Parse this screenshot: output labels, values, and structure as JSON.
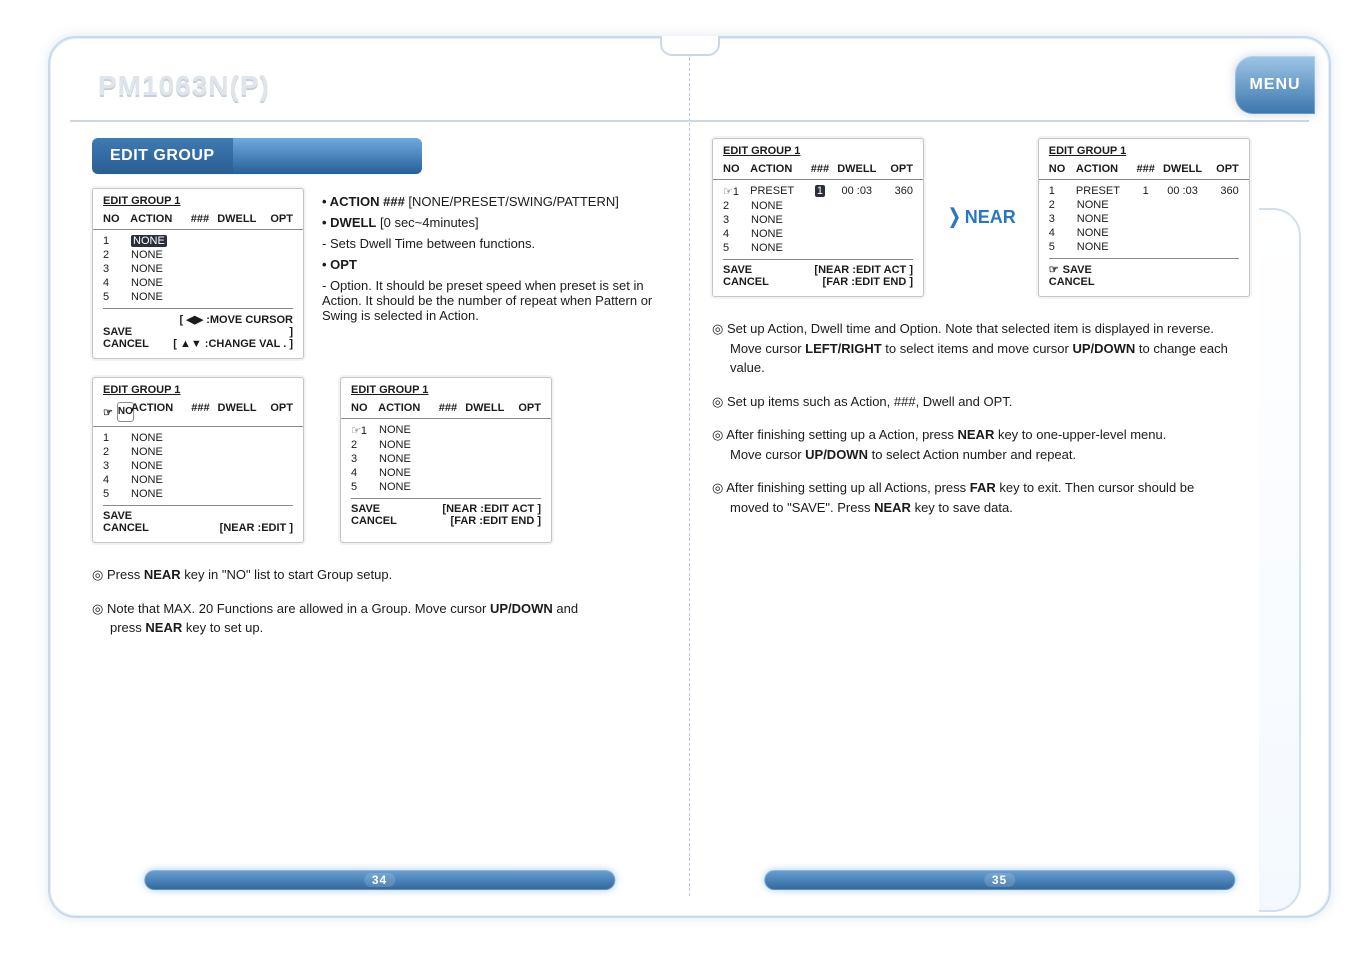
{
  "brand": "PM1063N(P)",
  "menu_label": "MENU",
  "section_title": "EDIT GROUP",
  "panels": {
    "p1": {
      "title": "EDIT GROUP   1",
      "head": {
        "no": "NO",
        "action": "ACTION",
        "hash": "###",
        "dwell": "DWELL",
        "opt": "OPT"
      },
      "rows": [
        {
          "no": "1",
          "action": "NONE",
          "rev": true
        },
        {
          "no": "2",
          "action": "NONE"
        },
        {
          "no": "3",
          "action": "NONE"
        },
        {
          "no": "4",
          "action": "NONE"
        },
        {
          "no": "5",
          "action": "NONE"
        }
      ],
      "foot_l1": "SAVE",
      "foot_l2": "CANCEL",
      "foot_r1": "[ ◀▶ :MOVE CURSOR   ]",
      "foot_r2": "[ ▲▼ :CHANGE VAL  .  ]"
    },
    "p2": {
      "title": "EDIT GROUP   1",
      "head": {
        "no": "NO",
        "action": "ACTION",
        "hash": "###",
        "dwell": "DWELL",
        "opt": "OPT"
      },
      "sel_head": "no",
      "rows": [
        {
          "no": "1",
          "action": "NONE"
        },
        {
          "no": "2",
          "action": "NONE"
        },
        {
          "no": "3",
          "action": "NONE"
        },
        {
          "no": "4",
          "action": "NONE"
        },
        {
          "no": "5",
          "action": "NONE"
        }
      ],
      "foot_l1": "SAVE",
      "foot_l2": "CANCEL",
      "foot_r2": "[NEAR  :EDIT ]"
    },
    "p3": {
      "title": "EDIT GROUP   1",
      "head": {
        "no": "NO",
        "action": "ACTION",
        "hash": "###",
        "dwell": "DWELL",
        "opt": "OPT"
      },
      "rows": [
        {
          "no": "1",
          "action": "NONE",
          "sel": true
        },
        {
          "no": "2",
          "action": "NONE"
        },
        {
          "no": "3",
          "action": "NONE"
        },
        {
          "no": "4",
          "action": "NONE"
        },
        {
          "no": "5",
          "action": "NONE"
        }
      ],
      "foot_l1": "SAVE",
      "foot_l2": "CANCEL",
      "foot_r1": "[NEAR :EDIT ACT  ]",
      "foot_r2": "[FAR    :EDIT END  ]"
    },
    "p4": {
      "title": "EDIT GROUP   1",
      "head": {
        "no": "NO",
        "action": "ACTION",
        "hash": "###",
        "dwell": "DWELL",
        "opt": "OPT"
      },
      "rows": [
        {
          "no": "1",
          "action": "PRESET",
          "sel": true,
          "hash": "1",
          "hash_rev": true,
          "dwell": "00 :03",
          "opt": "360"
        },
        {
          "no": "2",
          "action": "NONE"
        },
        {
          "no": "3",
          "action": "NONE"
        },
        {
          "no": "4",
          "action": "NONE"
        },
        {
          "no": "5",
          "action": "NONE"
        }
      ],
      "foot_l1": "SAVE",
      "foot_l2": "CANCEL",
      "foot_r1": "[NEAR :EDIT ACT  ]",
      "foot_r2": "[FAR    :EDIT END  ]"
    },
    "p5": {
      "title": "EDIT GROUP   1",
      "head": {
        "no": "NO",
        "action": "ACTION",
        "hash": "###",
        "dwell": "DWELL",
        "opt": "OPT"
      },
      "rows": [
        {
          "no": "1",
          "action": "PRESET",
          "hash": "1",
          "dwell": "00 :03",
          "opt": "360"
        },
        {
          "no": "2",
          "action": "NONE"
        },
        {
          "no": "3",
          "action": "NONE"
        },
        {
          "no": "4",
          "action": "NONE"
        },
        {
          "no": "5",
          "action": "NONE"
        }
      ],
      "foot_l1": "SAVE",
      "sel_save": true,
      "foot_l2": "CANCEL"
    }
  },
  "near_label": "NEAR",
  "bullets": {
    "b1_lead": "• ACTION ###",
    "b1_rest": " [NONE/PRESET/SWING/PATTERN]",
    "b2_lead": "• DWELL",
    "b2_rest": " [0 sec~4minutes]",
    "b2_sub": "  - Sets Dwell Time between functions.",
    "b3_lead": "• OPT",
    "b3_sub": "  - Option. It should be preset speed when preset is set in Action. It should be the number of repeat when Pattern or Swing is selected in Action."
  },
  "notes_left": {
    "n1_a": "Press ",
    "n1_b": "NEAR",
    "n1_c": " key in \"NO\" list to start Group setup.",
    "n2_a": "Note that MAX. 20 Functions are allowed in a Group. Move cursor ",
    "n2_b": "UP/DOWN",
    "n2_c": " and",
    "n2_d": "press  ",
    "n2_e": "NEAR",
    "n2_f": " key to set up."
  },
  "notes_right": {
    "r1_a": "Set up Action, Dwell time and Option. Note that selected item is displayed in reverse.",
    "r1_b": "Move cursor ",
    "r1_c": "LEFT/RIGHT",
    "r1_d": " to select items and move cursor ",
    "r1_e": "UP/DOWN",
    "r1_f": " to change each",
    "r1_g": "value.",
    "r2": "Set up items such as Action, ###, Dwell and OPT.",
    "r3_a": "After finishing setting up a Action, press ",
    "r3_b": "NEAR",
    "r3_c": " key to one-upper-level menu.",
    "r3_d": "Move cursor ",
    "r3_e": "UP/DOWN",
    "r3_f": " to select Action number and repeat.",
    "r4_a": "After finishing setting up all Actions, press ",
    "r4_b": "FAR",
    "r4_c": " key to exit. Then cursor should be",
    "r4_d": "moved to \"SAVE\". Press ",
    "r4_e": "NEAR",
    "r4_f": " key to save data."
  },
  "page_left": "34",
  "page_right": "35"
}
